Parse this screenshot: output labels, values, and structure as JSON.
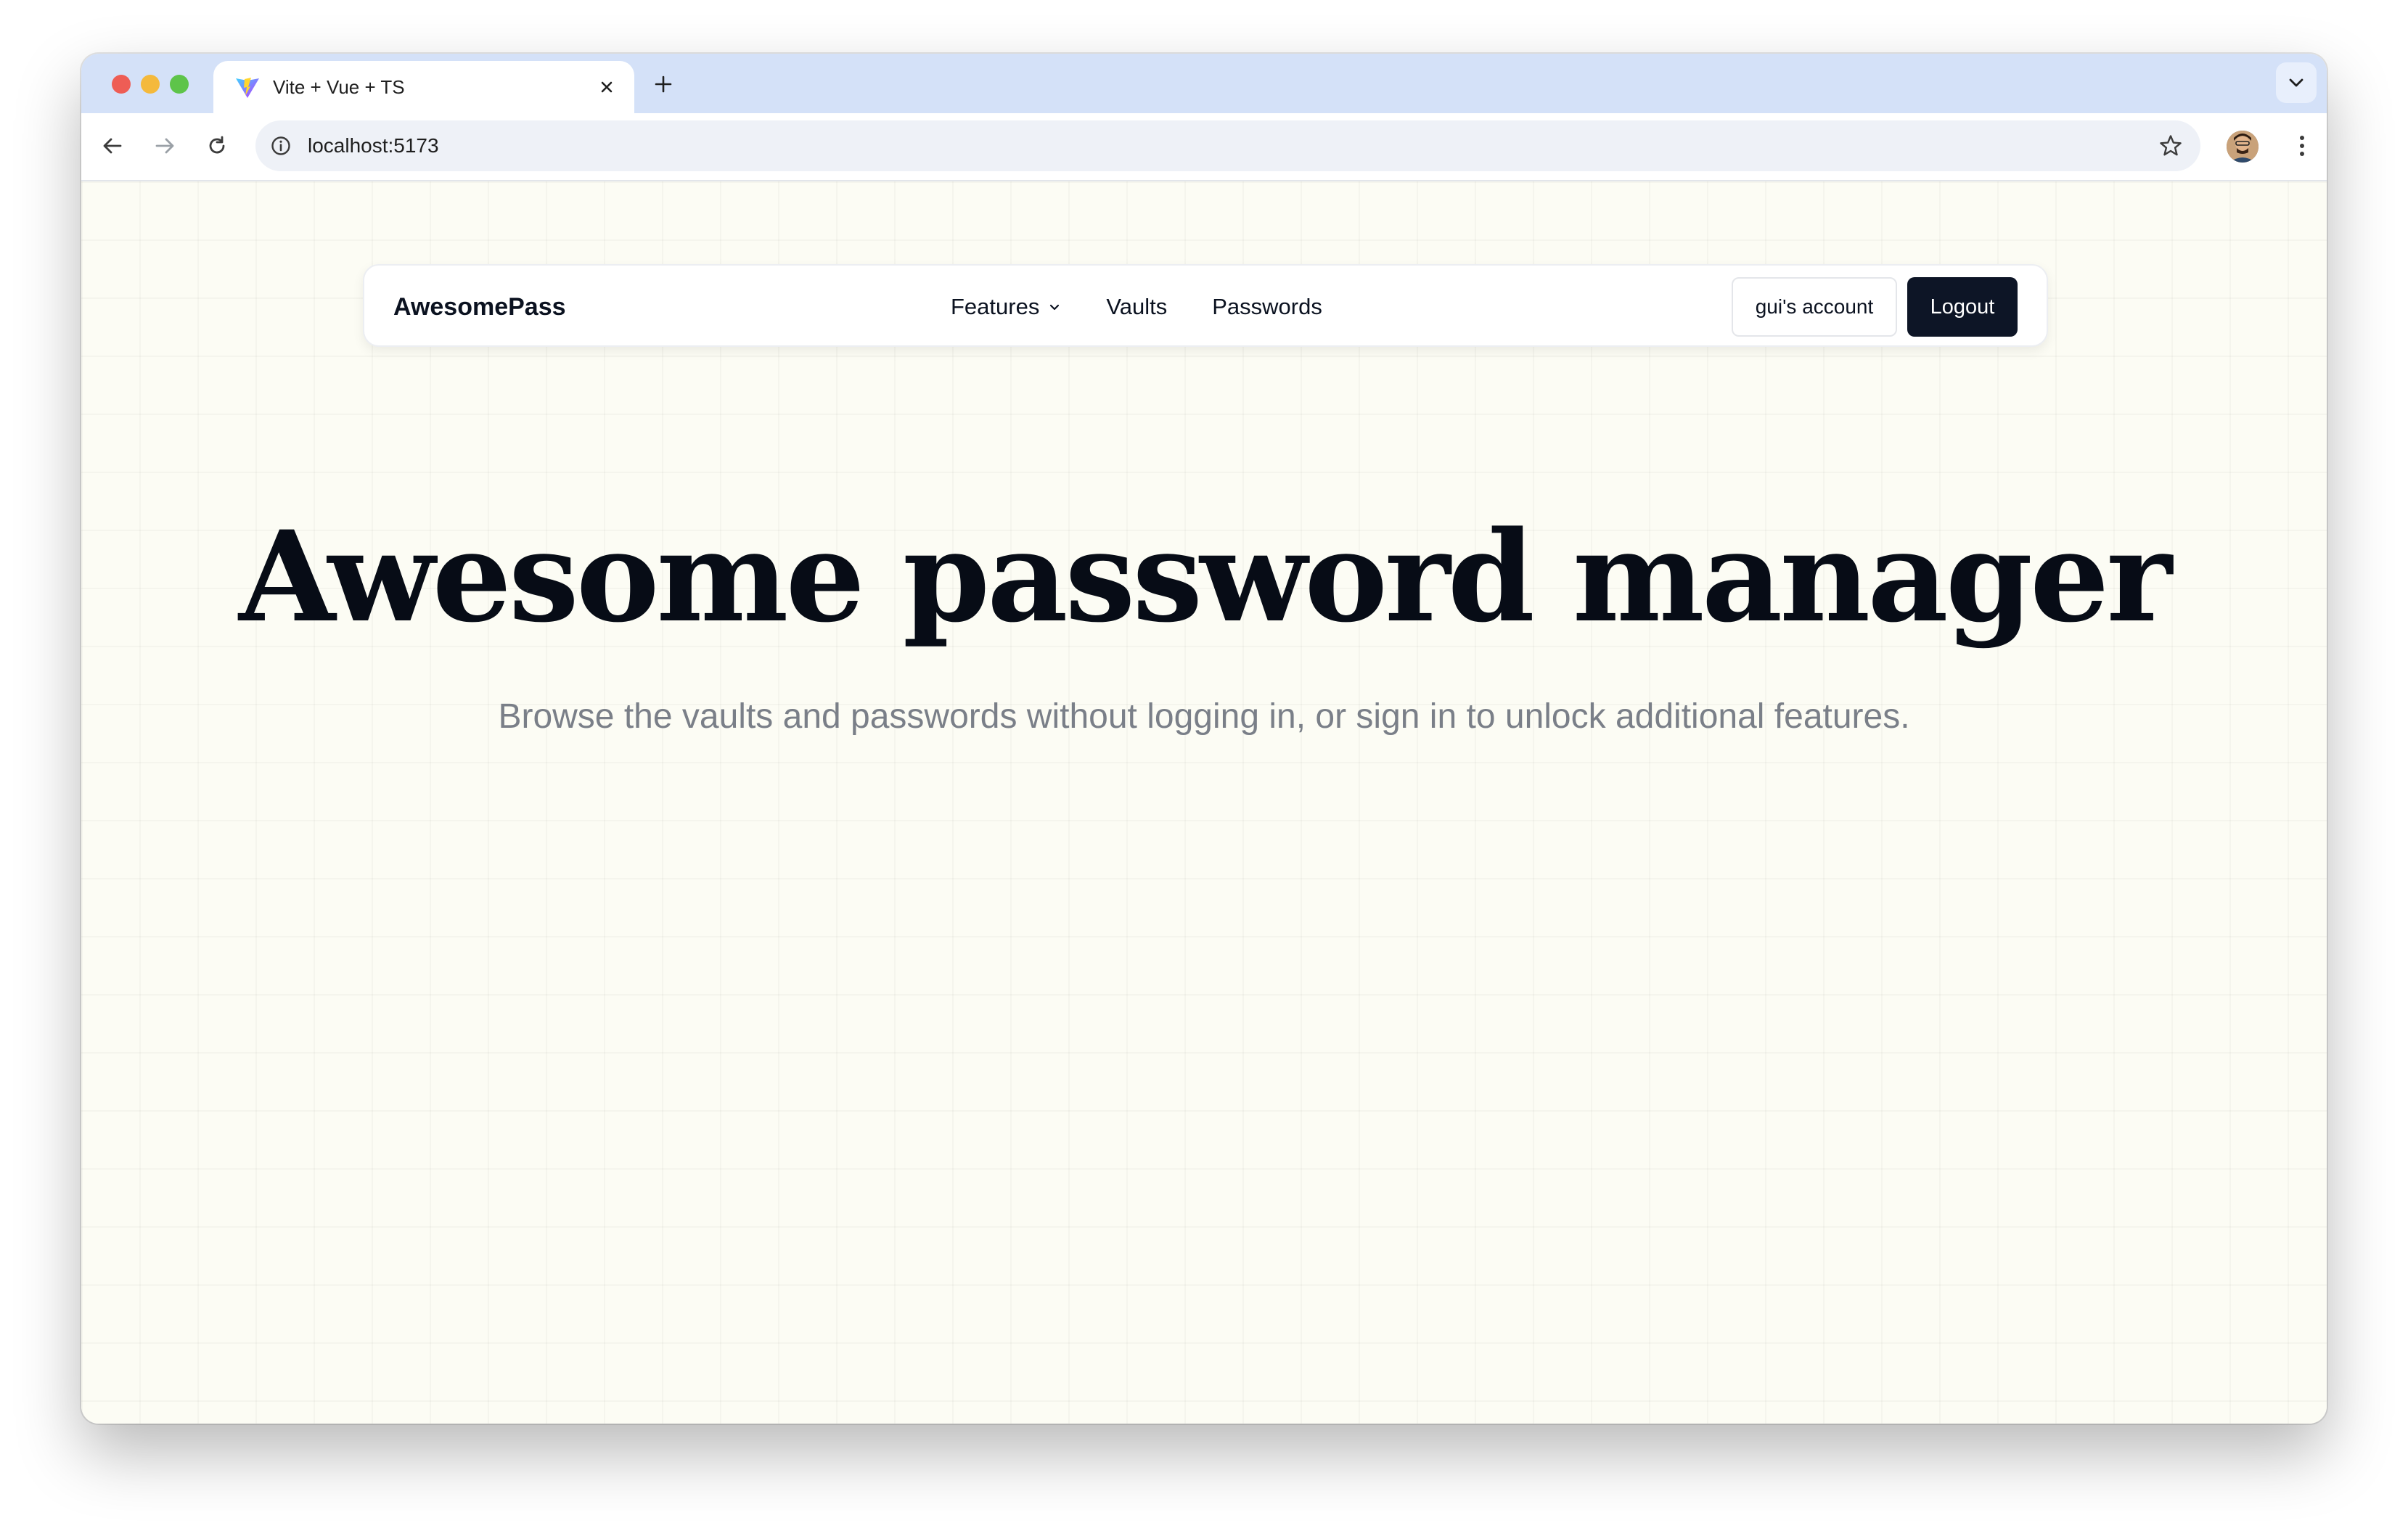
{
  "browser": {
    "tab": {
      "title": "Vite + Vue + TS",
      "favicon": "vite-logo-icon"
    },
    "address_bar": {
      "url": "localhost:5173"
    },
    "icons": {
      "back": "arrow-left-icon",
      "forward": "arrow-right-icon",
      "reload": "reload-icon",
      "site_info": "info-icon",
      "bookmark": "star-icon",
      "menu": "kebab-menu-icon",
      "new_tab": "plus-icon",
      "tab_close": "close-icon",
      "tab_search": "chevron-down-icon"
    }
  },
  "site": {
    "brand": "AwesomePass",
    "nav": {
      "features": "Features",
      "vaults": "Vaults",
      "passwords": "Passwords"
    },
    "account_button": "gui's account",
    "logout_button": "Logout"
  },
  "hero": {
    "title": "Awesome password manager",
    "subtitle": "Browse the vaults and passwords without logging in, or sign in to unlock additional features."
  },
  "colors": {
    "tabstrip": "#d4e1f8",
    "page_background": "#fcfcf4",
    "logout_button": "#0d1526",
    "heading": "#070c16",
    "subtitle": "#7a7f88"
  }
}
